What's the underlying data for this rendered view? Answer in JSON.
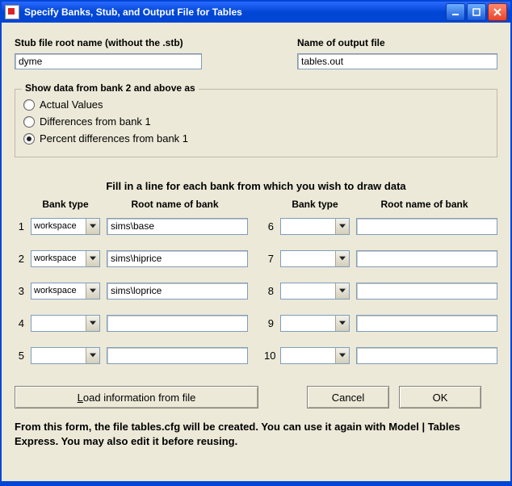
{
  "window": {
    "title": "Specify Banks, Stub, and Output File for Tables"
  },
  "labels": {
    "stub": "Stub file root name (without the .stb)",
    "output": "Name of output file",
    "group_legend": "Show data from bank 2 and above as",
    "radio_actual": "Actual Values",
    "radio_diff": "Differences from bank 1",
    "radio_pct": "Percent differences from bank 1",
    "instruction": "Fill in a line for each bank from which you wish to draw data",
    "hdr_type": "Bank type",
    "hdr_name": "Root name of bank",
    "btn_load": "Load information from file",
    "btn_cancel": "Cancel",
    "btn_ok": "OK",
    "footnote": "From this form, the file tables.cfg will be created.  You can use it again with Model | Tables Express.  You may also edit it before reusing."
  },
  "fields": {
    "stub": "dyme",
    "output": "tables.out"
  },
  "radio_selected": "pct",
  "banks_left": [
    {
      "n": "1",
      "type": "workspace",
      "name": "sims\\base"
    },
    {
      "n": "2",
      "type": "workspace",
      "name": "sims\\hiprice"
    },
    {
      "n": "3",
      "type": "workspace",
      "name": "sims\\loprice"
    },
    {
      "n": "4",
      "type": "",
      "name": ""
    },
    {
      "n": "5",
      "type": "",
      "name": ""
    }
  ],
  "banks_right": [
    {
      "n": "6",
      "type": "",
      "name": ""
    },
    {
      "n": "7",
      "type": "",
      "name": ""
    },
    {
      "n": "8",
      "type": "",
      "name": ""
    },
    {
      "n": "9",
      "type": "",
      "name": ""
    },
    {
      "n": "10",
      "type": "",
      "name": ""
    }
  ]
}
